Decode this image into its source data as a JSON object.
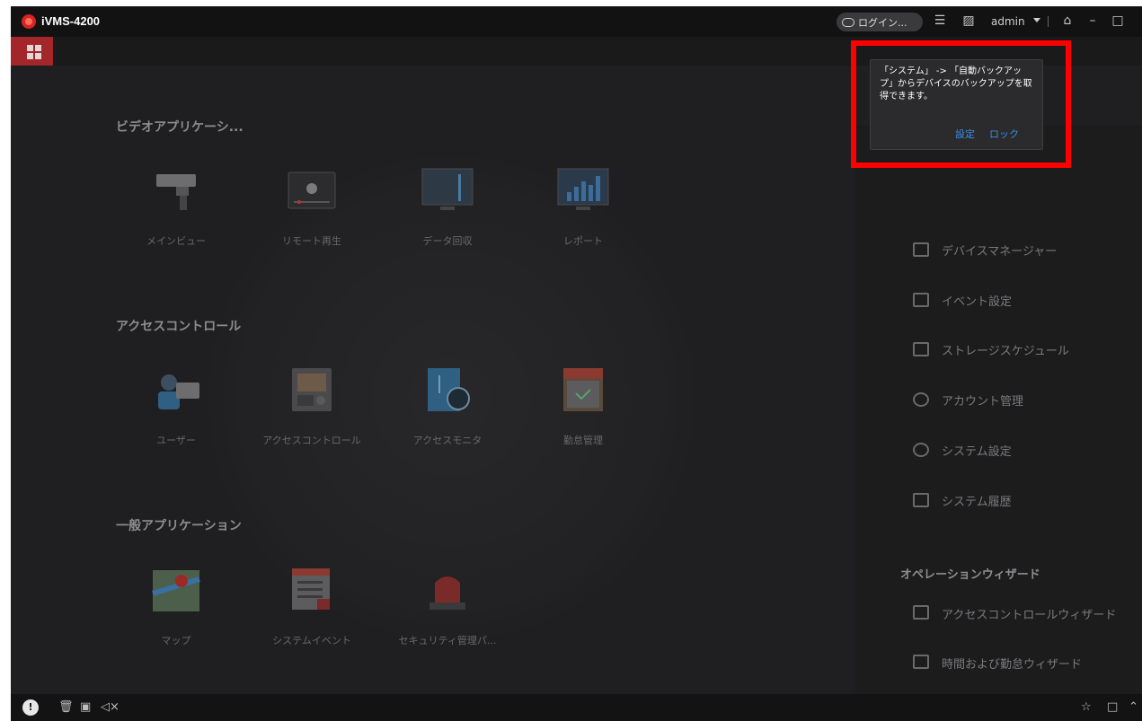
{
  "app": {
    "title": "iVMS-4200"
  },
  "titlebar": {
    "login_label": "ログイン...",
    "user": "admin"
  },
  "sections": [
    {
      "title": "ビデオアプリケーシ...",
      "items": [
        {
          "label": "メインビュー",
          "icon": "camera-icon"
        },
        {
          "label": "リモート再生",
          "icon": "playback-icon"
        },
        {
          "label": "データ回収",
          "icon": "monitor-icon"
        },
        {
          "label": "レポート",
          "icon": "report-chart-icon"
        }
      ]
    },
    {
      "title": "アクセスコントロール",
      "items": [
        {
          "label": "ユーザー",
          "icon": "user-card-icon"
        },
        {
          "label": "アクセスコントロール",
          "icon": "intercom-icon"
        },
        {
          "label": "アクセスモニタ",
          "icon": "door-monitor-icon"
        },
        {
          "label": "勤怠管理",
          "icon": "calendar-icon"
        }
      ]
    },
    {
      "title": "一般アプリケーション",
      "items": [
        {
          "label": "マップ",
          "icon": "map-icon"
        },
        {
          "label": "システムイベント",
          "icon": "event-list-icon"
        },
        {
          "label": "セキュリティ管理パ...",
          "icon": "alarm-light-icon"
        }
      ]
    }
  ],
  "right_panel": {
    "items": [
      {
        "label": "デバイスマネージャー",
        "icon": "device-icon"
      },
      {
        "label": "イベント設定",
        "icon": "event-config-icon"
      },
      {
        "label": "ストレージスケジュール",
        "icon": "storage-icon"
      },
      {
        "label": "アカウント管理",
        "icon": "account-icon"
      },
      {
        "label": "システム設定",
        "icon": "gear-icon"
      },
      {
        "label": "システム履歴",
        "icon": "log-icon"
      }
    ],
    "wizard_header": "オペレーションウィザード",
    "wizards": [
      {
        "label": "アクセスコントロールウィザード",
        "icon": "door-wizard-icon"
      },
      {
        "label": "時間および勤怠ウィザード",
        "icon": "calendar-wizard-icon"
      }
    ]
  },
  "popup": {
    "text": "「システム」 -> 「自動バックアップ」からデバイスのバックアップを取得できます。",
    "setting": "設定",
    "lock": "ロック"
  },
  "colors": {
    "accent": "#a3262a",
    "highlight": "#ff0000",
    "link": "#3c8ee6"
  }
}
